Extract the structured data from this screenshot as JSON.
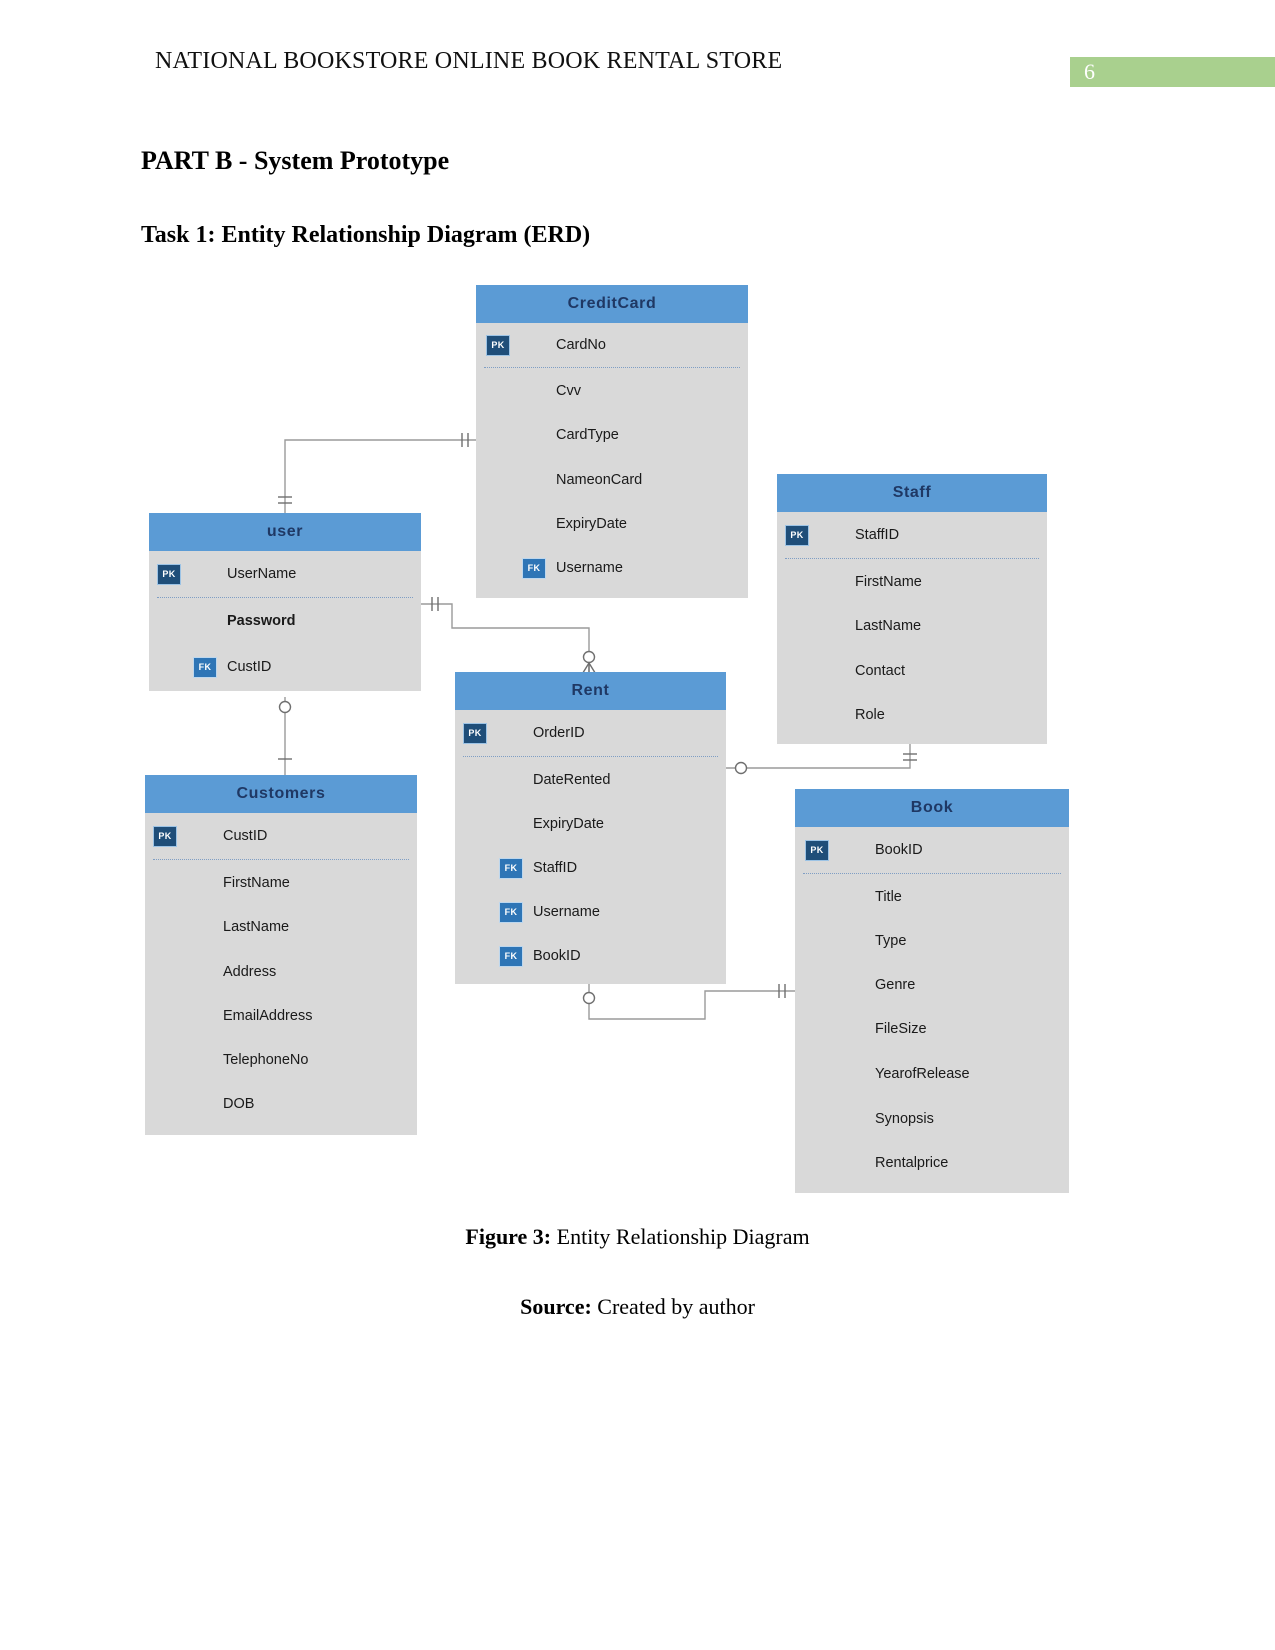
{
  "header": {
    "running_head": "NATIONAL BOOKSTORE ONLINE BOOK RENTAL STORE",
    "page_number": "6",
    "badge_color": "#a9d08e"
  },
  "headings": {
    "part": "PART B - System Prototype",
    "task": "Task 1: Entity Relationship Diagram (ERD)"
  },
  "caption": {
    "figure_label": "Figure 3:",
    "figure_text": " Entity Relationship Diagram",
    "source_label": "Source:",
    "source_text": " Created by author"
  },
  "diagram": {
    "title": "Entity Relationship Diagram",
    "type": "erd",
    "theme": {
      "header_fill": "#5b9bd5",
      "header_text": "#1f3864",
      "body_fill": "#d9d9d9",
      "pk_badge": "#1f4e79",
      "fk_badge": "#2e75b6",
      "connector": "#808080"
    },
    "entities": [
      {
        "name": "CreditCard",
        "attributes": [
          {
            "key": "PK",
            "name": "CardNo"
          },
          {
            "key": "",
            "name": "Cvv"
          },
          {
            "key": "",
            "name": "CardType"
          },
          {
            "key": "",
            "name": "NameonCard"
          },
          {
            "key": "",
            "name": "ExpiryDate"
          },
          {
            "key": "FK",
            "name": "Username"
          }
        ]
      },
      {
        "name": "user",
        "attributes": [
          {
            "key": "PK",
            "name": "UserName"
          },
          {
            "key": "",
            "name": "Password",
            "bold": true
          },
          {
            "key": "FK",
            "name": "CustID"
          }
        ]
      },
      {
        "name": "Staff",
        "attributes": [
          {
            "key": "PK",
            "name": "StaffID"
          },
          {
            "key": "",
            "name": "FirstName"
          },
          {
            "key": "",
            "name": "LastName"
          },
          {
            "key": "",
            "name": "Contact"
          },
          {
            "key": "",
            "name": "Role"
          }
        ]
      },
      {
        "name": "Customers",
        "attributes": [
          {
            "key": "PK",
            "name": "CustID"
          },
          {
            "key": "",
            "name": "FirstName"
          },
          {
            "key": "",
            "name": "LastName"
          },
          {
            "key": "",
            "name": "Address"
          },
          {
            "key": "",
            "name": "EmailAddress"
          },
          {
            "key": "",
            "name": "TelephoneNo"
          },
          {
            "key": "",
            "name": "DOB"
          }
        ]
      },
      {
        "name": "Rent",
        "attributes": [
          {
            "key": "PK",
            "name": "OrderID"
          },
          {
            "key": "",
            "name": "DateRented"
          },
          {
            "key": "",
            "name": "ExpiryDate"
          },
          {
            "key": "FK",
            "name": "StaffID"
          },
          {
            "key": "FK",
            "name": "Username"
          },
          {
            "key": "FK",
            "name": "BookID"
          }
        ]
      },
      {
        "name": "Book",
        "attributes": [
          {
            "key": "PK",
            "name": "BookID"
          },
          {
            "key": "",
            "name": "Title"
          },
          {
            "key": "",
            "name": "Type"
          },
          {
            "key": "",
            "name": "Genre"
          },
          {
            "key": "",
            "name": "FileSize"
          },
          {
            "key": "",
            "name": "YearofRelease"
          },
          {
            "key": "",
            "name": "Synopsis"
          },
          {
            "key": "",
            "name": "Rentalprice"
          }
        ]
      }
    ],
    "relationships": [
      {
        "from": "user",
        "to": "CreditCard",
        "from_card": "one",
        "to_card": "one"
      },
      {
        "from": "user",
        "to": "Rent",
        "from_card": "one",
        "to_card": "many"
      },
      {
        "from": "user",
        "to": "Customers",
        "from_card": "many",
        "to_card": "one"
      },
      {
        "from": "Rent",
        "to": "Staff",
        "from_card": "many",
        "to_card": "one"
      },
      {
        "from": "Rent",
        "to": "Book",
        "from_card": "many",
        "to_card": "one"
      }
    ]
  }
}
